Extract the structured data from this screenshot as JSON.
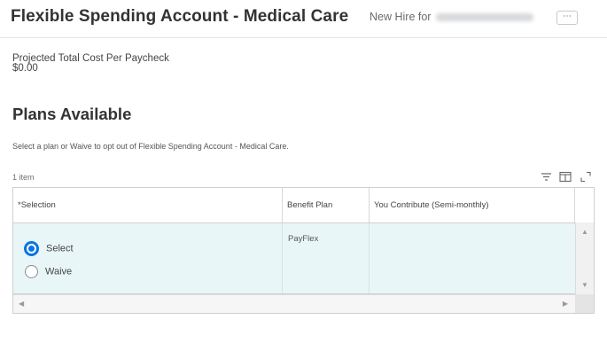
{
  "header": {
    "title": "Flexible Spending Account - Medical Care",
    "subtitle_prefix": "New Hire for",
    "more_label": "⋯"
  },
  "cost": {
    "label": "Projected Total Cost Per Paycheck",
    "value": "$0.00"
  },
  "plans": {
    "title": "Plans Available",
    "instruction": "Select a plan or Waive to opt out of Flexible Spending Account - Medical Care.",
    "item_count": "1 item",
    "toolbar_icons": [
      "filter-icon",
      "columns-icon",
      "fullscreen-icon"
    ],
    "columns": [
      "*Selection",
      "Benefit Plan",
      "You Contribute (Semi-monthly)"
    ],
    "row": {
      "options": [
        {
          "label": "Select",
          "selected": true
        },
        {
          "label": "Waive",
          "selected": false
        }
      ],
      "benefit_plan": "PayFlex",
      "contribution": ""
    }
  },
  "colors": {
    "accent": "#0875e1",
    "row_highlight": "#e9f6f8"
  }
}
